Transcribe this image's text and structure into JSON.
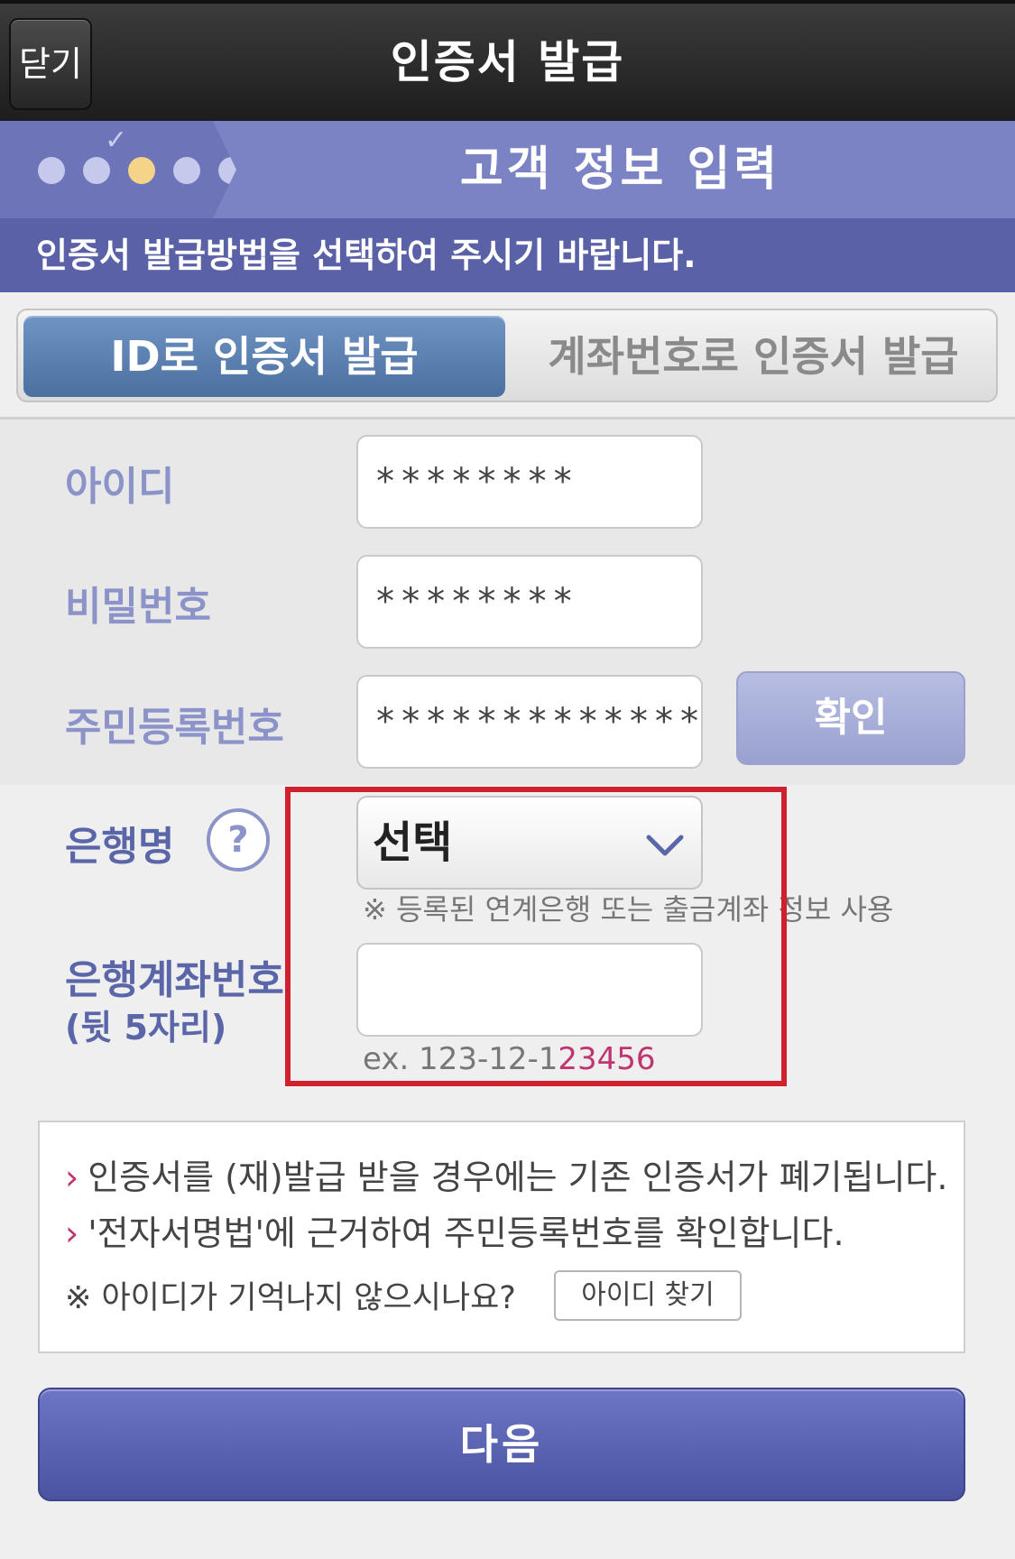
{
  "titlebar": {
    "close_label": "닫기",
    "title": "인증서 발급"
  },
  "step": {
    "title": "고객 정보 입력",
    "total_steps": 5,
    "current_step": 3,
    "instruction": "인증서 발급방법을 선택하여 주시기 바랍니다."
  },
  "tabs": {
    "active_label": "ID로 인증서 발급",
    "inactive_label": "계좌번호로 인증서 발급"
  },
  "form": {
    "id_label": "아이디",
    "id_value": "********",
    "password_label": "비밀번호",
    "password_value": "********",
    "resident_label": "주민등록번호",
    "resident_value": "*************",
    "confirm_label": "확인",
    "bank_label": "은행명",
    "help_symbol": "?",
    "bank_select_value": "선택",
    "bank_note": "※ 등록된 연계은행 또는 출금계좌 정보 사용",
    "account_label": "은행계좌번호",
    "account_sublabel": "(뒷 5자리)",
    "account_value": "",
    "example_prefix": "ex. 123-12-1",
    "example_highlight": "23456"
  },
  "info": {
    "line1": "인증서를 (재)발급 받을 경우에는 기존 인증서가 폐기됩니다.",
    "line2": "'전자서명법'에 근거하여 주민등록번호를 확인합니다.",
    "line3": "※ 아이디가 기억나지 않으시나요?",
    "find_id_label": "아이디 찾기",
    "bullet": "›"
  },
  "next_label": "다음",
  "colors": {
    "accent": "#5a61a7",
    "highlight": "#d0202e",
    "example_accent": "#c0356f"
  }
}
